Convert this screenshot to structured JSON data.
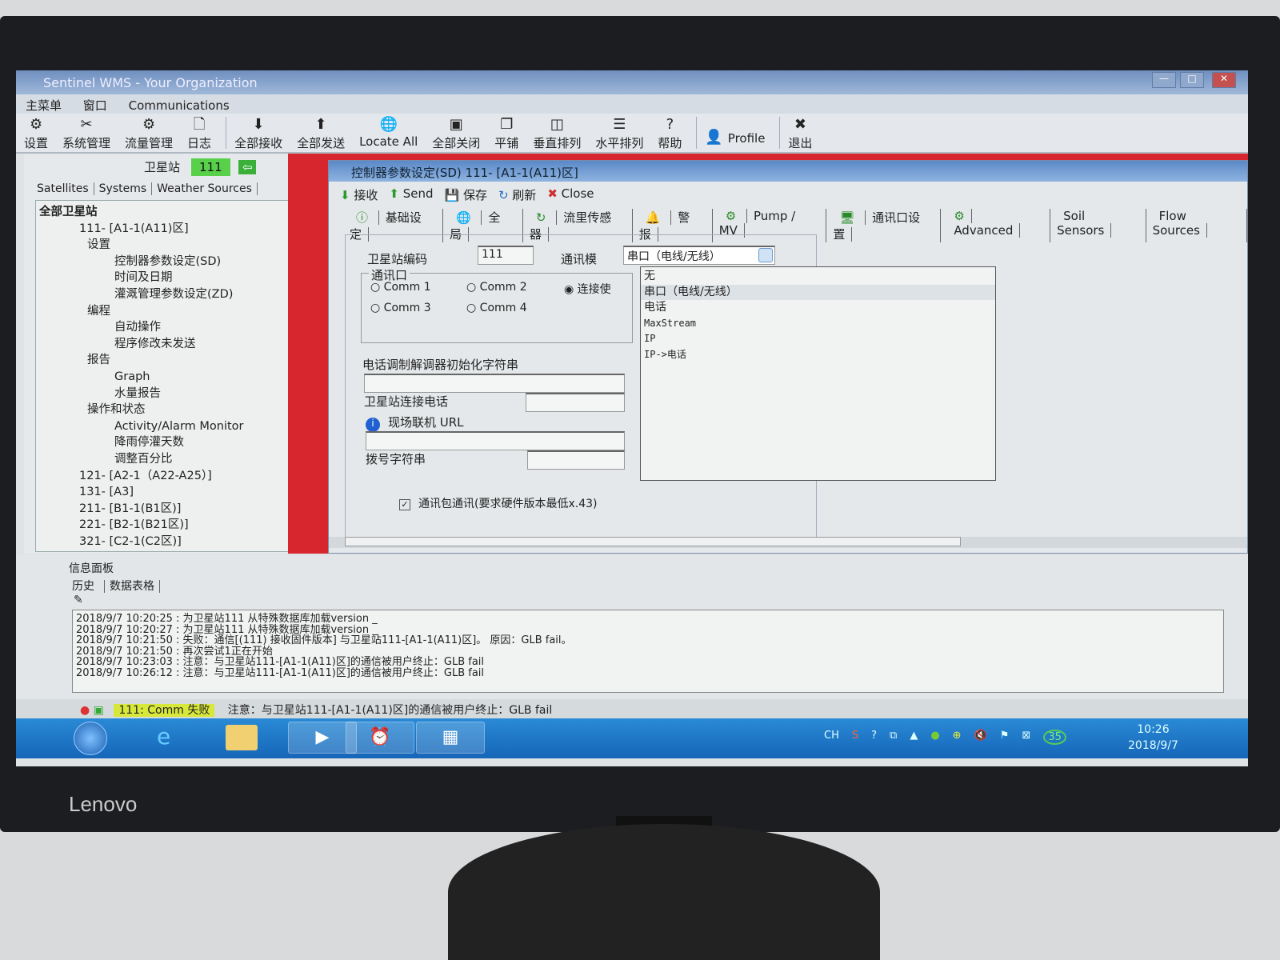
{
  "window": {
    "title": "Sentinel WMS - Your Organization",
    "min": "—",
    "max": "□",
    "close": "✕"
  },
  "menu": [
    "主菜单",
    "窗口",
    "Communications"
  ],
  "toolbar": [
    {
      "label": "设置",
      "icon": "gear-icon",
      "glyph": "⚙"
    },
    {
      "label": "系统管理",
      "icon": "tools-icon",
      "glyph": "✂"
    },
    {
      "label": "流量管理",
      "icon": "gears-icon",
      "glyph": "⚙"
    },
    {
      "label": "日志",
      "icon": "document-icon",
      "glyph": "🗋"
    },
    {
      "label": "全部接收",
      "icon": "arrow-down-icon",
      "glyph": "⬇"
    },
    {
      "label": "全部发送",
      "icon": "arrow-up-icon",
      "glyph": "⬆"
    },
    {
      "label": "Locate All",
      "icon": "globe-icon",
      "glyph": "🌐"
    },
    {
      "label": "全部关闭",
      "icon": "close-all-icon",
      "glyph": "▣"
    },
    {
      "label": "平铺",
      "icon": "cascade-icon",
      "glyph": "❐"
    },
    {
      "label": "垂直排列",
      "icon": "tile-vertical-icon",
      "glyph": "◫"
    },
    {
      "label": "水平排列",
      "icon": "tile-horizontal-icon",
      "glyph": "☰"
    },
    {
      "label": "帮助",
      "icon": "help-icon",
      "glyph": "?"
    },
    {
      "label": "Profile",
      "icon": "user-icon",
      "glyph": "👤"
    },
    {
      "label": "退出",
      "icon": "exit-icon",
      "glyph": "✖"
    }
  ],
  "station": {
    "label": "卫星站",
    "value": "111"
  },
  "left_tabs": [
    "Satellites",
    "Systems",
    "Weather Sources"
  ],
  "tree": [
    {
      "text": "全部卫星站",
      "level": 0
    },
    {
      "text": "111- [A1-1(A11)区]",
      "level": 1
    },
    {
      "text": "设置",
      "level": 2
    },
    {
      "text": "控制器参数设定(SD)",
      "level": 3
    },
    {
      "text": "时间及日期",
      "level": 3
    },
    {
      "text": "灌溉管理参数设定(ZD)",
      "level": 3
    },
    {
      "text": "编程",
      "level": 2
    },
    {
      "text": "自动操作",
      "level": 3
    },
    {
      "text": "程序修改未发送",
      "level": 3
    },
    {
      "text": "报告",
      "level": 2
    },
    {
      "text": "Graph",
      "level": 3
    },
    {
      "text": "水量报告",
      "level": 3
    },
    {
      "text": "操作和状态",
      "level": 2
    },
    {
      "text": "Activity/Alarm Monitor",
      "level": 3
    },
    {
      "text": "降雨停灌天数",
      "level": 3
    },
    {
      "text": "调整百分比",
      "level": 3
    },
    {
      "text": "121- [A2-1（A22-A25）]",
      "level": 1
    },
    {
      "text": "131- [A3]",
      "level": 1
    },
    {
      "text": "211- [B1-1(B1区)]",
      "level": 1
    },
    {
      "text": "221- [B2-1(B21区)]",
      "level": 1
    },
    {
      "text": "321- [C2-1(C2区)]",
      "level": 1
    }
  ],
  "child": {
    "title": "控制器参数设定(SD) 111- [A1-1(A11)区]",
    "toolbar": [
      {
        "label": "接收",
        "glyph": "⬇",
        "color": "#2a9a2a"
      },
      {
        "label": "Send",
        "glyph": "⬆",
        "color": "#2a9a2a"
      },
      {
        "label": "保存",
        "glyph": "💾",
        "color": "#3050b0"
      },
      {
        "label": "刷新",
        "glyph": "↻",
        "color": "#2a70c0"
      },
      {
        "label": "Close",
        "glyph": "✖",
        "color": "#d03030"
      }
    ],
    "tabs": [
      {
        "label": "基础设定",
        "glyph": "ⓘ"
      },
      {
        "label": "全局",
        "glyph": "🌐"
      },
      {
        "label": "流里传感器",
        "glyph": "↻"
      },
      {
        "label": "警报",
        "glyph": "🔔"
      },
      {
        "label": "Pump / MV",
        "glyph": "⚙"
      },
      {
        "label": "通讯口设置",
        "glyph": "🖥"
      },
      {
        "label": "Advanced",
        "glyph": "⚙"
      },
      {
        "label": "Soil Sensors",
        "glyph": ""
      },
      {
        "label": "Flow Sources",
        "glyph": ""
      }
    ],
    "station_code_label": "卫星站编码",
    "station_code": "111",
    "comm_mode_label": "通讯模",
    "comm_mode": "串口（电线/无线）",
    "comm_port_group": "通讯口",
    "ports": [
      {
        "label": "Comm 1",
        "checked": false
      },
      {
        "label": "Comm 2",
        "checked": false
      },
      {
        "label": "连接使",
        "checked": true
      },
      {
        "label": "Comm 3",
        "checked": false
      },
      {
        "label": "Comm 4",
        "checked": false
      }
    ],
    "modem_init_label": "电话调制解调器初始化字符串",
    "station_phone_label": "卫星站连接电话",
    "url_label": "现场联机 URL",
    "dial_label": "拨号字符串",
    "packet_label": "通讯包通讯(要求硬件版本最低x.43)",
    "packet_checked": true,
    "dropdown_options": [
      "无",
      "串口（电线/无线）",
      "电话",
      "MaxStream",
      "IP",
      "IP->电话"
    ],
    "dropdown_selected": 1
  },
  "info": {
    "title": "信息面板",
    "tabs": [
      "历史",
      "数据表格"
    ],
    "log": [
      "2018/9/7 10:20:25 : 为卫星站111          从特殊数据库加载version _",
      "2018/9/7 10:20:27 : 为卫星站111          从特殊数据库加载version _",
      "2018/9/7 10:21:50 : 失败：通信[(111) 接收固件版本] 与卫星站111-[A1-1(A11)区]。 原因：GLB fail。",
      "2018/9/7 10:21:50 : 再次尝试1正在开始",
      "2018/9/7 10:23:03 : 注意：与卫星站111-[A1-1(A11)区]的通信被用户终止：GLB fail",
      "2018/9/7 10:26:12 : 注意：与卫星站111-[A1-1(A11)区]的通信被用户终止：GLB fail"
    ]
  },
  "status": {
    "comm": "111: Comm 失败",
    "message": "注意：与卫星站111-[A1-1(A11)区]的通信被用户终止：GLB fail"
  },
  "taskbar": {
    "tray_lang": "CH",
    "badge": "35",
    "time": "10:26",
    "date": "2018/9/7"
  },
  "brand": "Lenovo"
}
